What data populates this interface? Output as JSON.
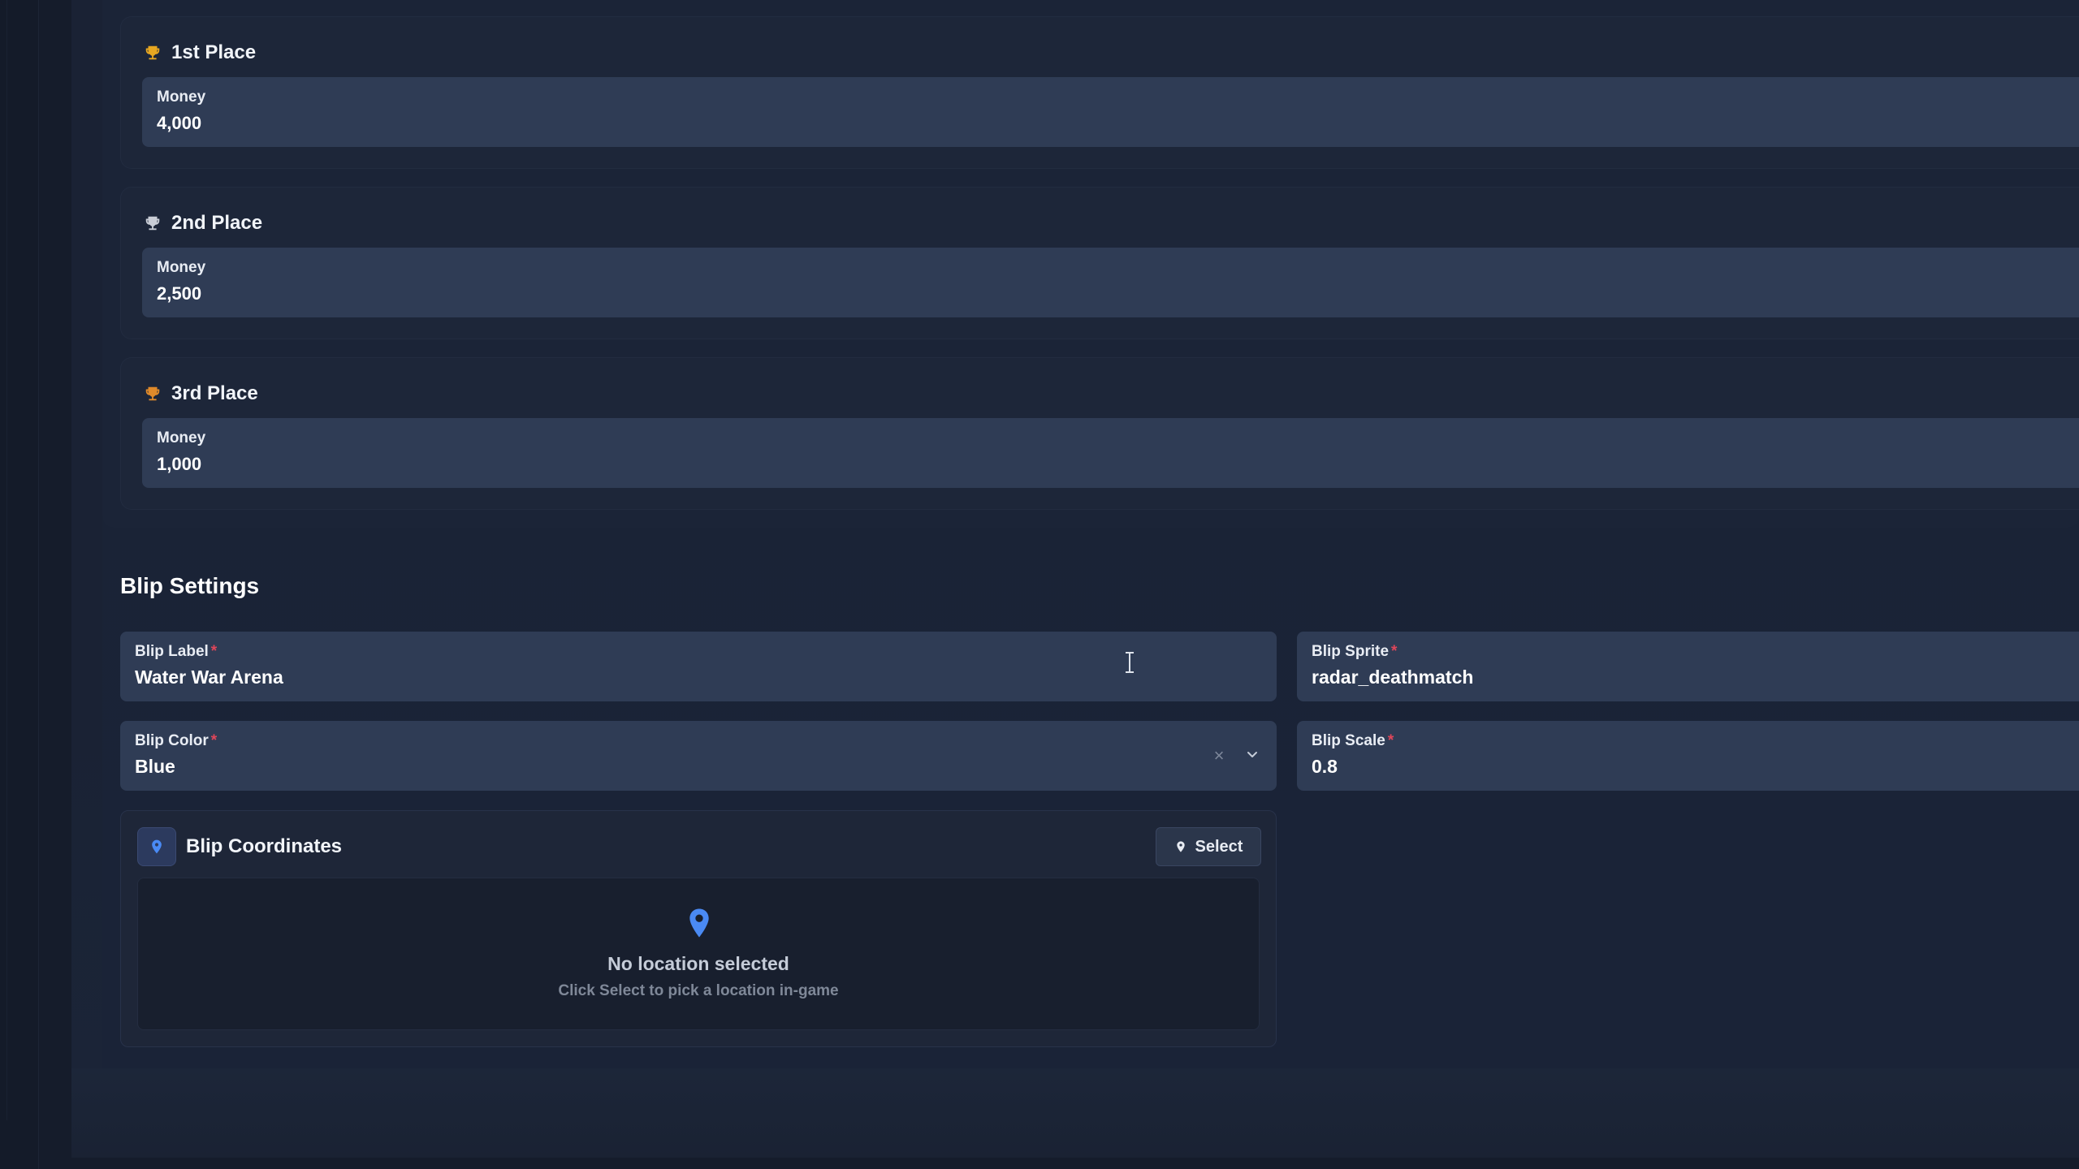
{
  "rewards": [
    {
      "place": "1st Place",
      "trophy_color": "#e7a721",
      "money_label": "Money",
      "money_value": "4,000"
    },
    {
      "place": "2nd Place",
      "trophy_color": "#c9cdd6",
      "money_label": "Money",
      "money_value": "2,500"
    },
    {
      "place": "3rd Place",
      "trophy_color": "#e08a2a",
      "money_label": "Money",
      "money_value": "1,000"
    }
  ],
  "blip": {
    "section_title": "Blip Settings",
    "label_field": {
      "label": "Blip Label",
      "required": "*",
      "value": "Water War Arena"
    },
    "sprite_field": {
      "label": "Blip Sprite",
      "required": "*",
      "value": "radar_deathmatch"
    },
    "color_field": {
      "label": "Blip Color",
      "required": "*",
      "value": "Blue"
    },
    "scale_field": {
      "label": "Blip Scale",
      "required": "*",
      "value": "0.8"
    },
    "coordinates": {
      "title": "Blip Coordinates",
      "select_label": "Select",
      "empty_title": "No location selected",
      "empty_subtitle": "Click Select to pick a location in-game"
    }
  },
  "colors": {
    "accent_blue": "#4a8af4",
    "required_red": "#e0465a"
  }
}
